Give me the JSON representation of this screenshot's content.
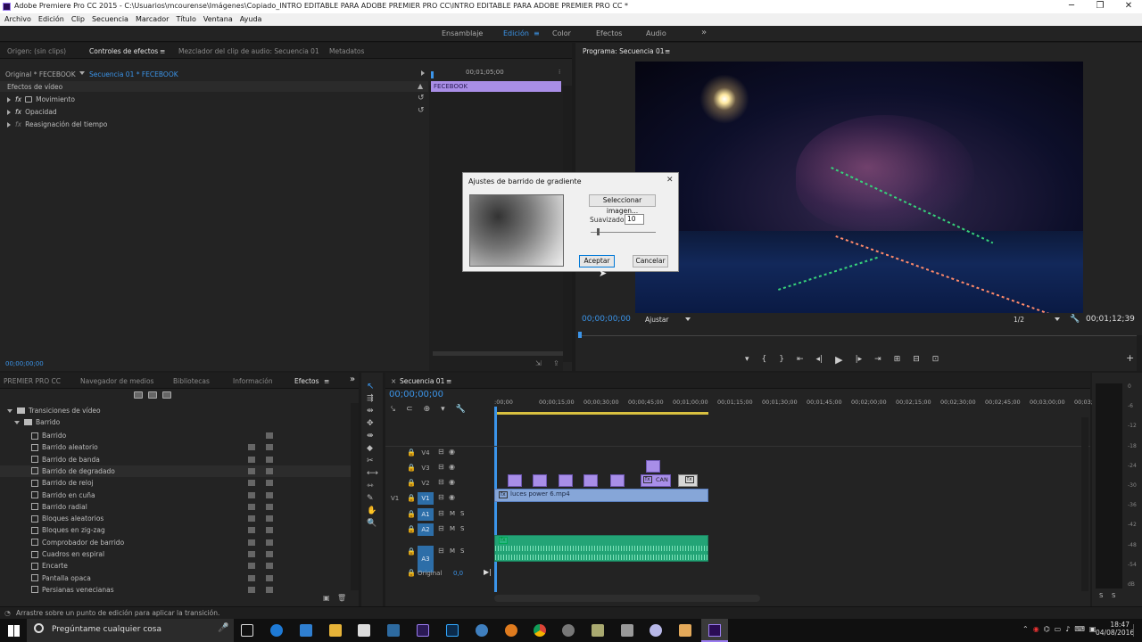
{
  "window": {
    "title": "Adobe Premiere Pro CC 2015 - C:\\Usuarios\\mcourense\\Imágenes\\Copiado_INTRO EDITABLE PARA ADOBE  PREMIER PRO CC\\INTRO EDITABLE PARA ADOBE  PREMIER PRO CC *",
    "minimize": "─",
    "maximize": "❐",
    "close": "✕"
  },
  "menu": [
    "Archivo",
    "Edición",
    "Clip",
    "Secuencia",
    "Marcador",
    "Título",
    "Ventana",
    "Ayuda"
  ],
  "workspaces": {
    "items": [
      "Ensamblaje",
      "Edición",
      "Color",
      "Efectos",
      "Audio"
    ],
    "active": "Edición",
    "menu": "≡",
    "more": "»"
  },
  "source_panel": {
    "tabs": [
      "Origen: (sin clips)",
      "Controles de efectos",
      "Mezclador del clip de audio: Secuencia 01",
      "Metadatos"
    ],
    "active_tab": "Controles de efectos",
    "tab_menu": "≡",
    "master": "Original * FECEBOOK",
    "sequence": "Secuencia 01 * FECEBOOK",
    "time_ruler": "00;01;05;00",
    "clip_label": "FECEBOOK",
    "section": "Efectos de vídeo",
    "effects": [
      "Movimiento",
      "Opacidad",
      "Reasignación del tiempo"
    ],
    "timecode": "00;00;00;00"
  },
  "program_panel": {
    "title": "Programa: Secuencia 01",
    "menu": "≡",
    "timecode": "00;00;00;00",
    "fit": "Ajustar",
    "resolution": "1/2",
    "duration": "00;01;12;39"
  },
  "dialog": {
    "title": "Ajustes de barrido de gradiente",
    "close": "✕",
    "select_image": "Seleccionar imagen...",
    "smoothness_label": "Suavizado:",
    "smoothness_value": "10",
    "ok": "Aceptar",
    "cancel": "Cancelar"
  },
  "project_panel": {
    "tabs": [
      "PREMIER PRO CC",
      "Navegador de medios",
      "Bibliotecas",
      "Información",
      "Efectos"
    ],
    "active_tab": "Efectos",
    "tab_menu": "≡",
    "more": "»",
    "tree_root": "Transiciones de vídeo",
    "folder": "Barrido",
    "items": [
      "Barrido",
      "Barrido aleatorio",
      "Barrido de banda",
      "Barrido de degradado",
      "Barrido de reloj",
      "Barrido en cuña",
      "Barrido radial",
      "Bloques aleatorios",
      "Bloques en zig-zag",
      "Comprobador de barrido",
      "Cuadros en espiral",
      "Encarte",
      "Pantalla opaca",
      "Persianas venecianas"
    ],
    "selected": "Barrido de degradado"
  },
  "timeline": {
    "title": "Secuencia 01",
    "close": "×",
    "menu": "≡",
    "timecode": "00;00;00;00",
    "ruler": [
      ":00;00",
      "00;00;15;00",
      "00;00;30;00",
      "00;00;45;00",
      "00;01;00;00",
      "00;01;15;00",
      "00;01;30;00",
      "00;01;45;00",
      "00;02;00;00",
      "00;02;15;00",
      "00;02;30;00",
      "00;02;45;00",
      "00;03;00;00",
      "00;03;1"
    ],
    "video_tracks": [
      "V4",
      "V3",
      "V2",
      "V1"
    ],
    "audio_tracks": [
      "A1",
      "A2",
      "A3"
    ],
    "src_label": "V1",
    "mute": "M",
    "solo": "S",
    "master_label": "Original",
    "master_value": "0,0",
    "clip_v1": "luces power 6.mp4",
    "clip_v2": "CAN",
    "fx": "fx"
  },
  "meter": {
    "labels": [
      "0",
      "-6",
      "-12",
      "-18",
      "-24",
      "-30",
      "-36",
      "-42",
      "-48",
      "-54",
      "dB"
    ],
    "solo": [
      "S",
      "S"
    ]
  },
  "status": "Arrastre sobre un punto de edición para aplicar la transición.",
  "taskbar": {
    "search": "Pregúntame cualquier cosa",
    "time": "18:47",
    "date": "04/08/2016"
  },
  "colors": {
    "accent": "#3b94e8",
    "clip": "#a98ee6",
    "audio": "#29b07c",
    "track_blue": "#2d6ea8"
  }
}
